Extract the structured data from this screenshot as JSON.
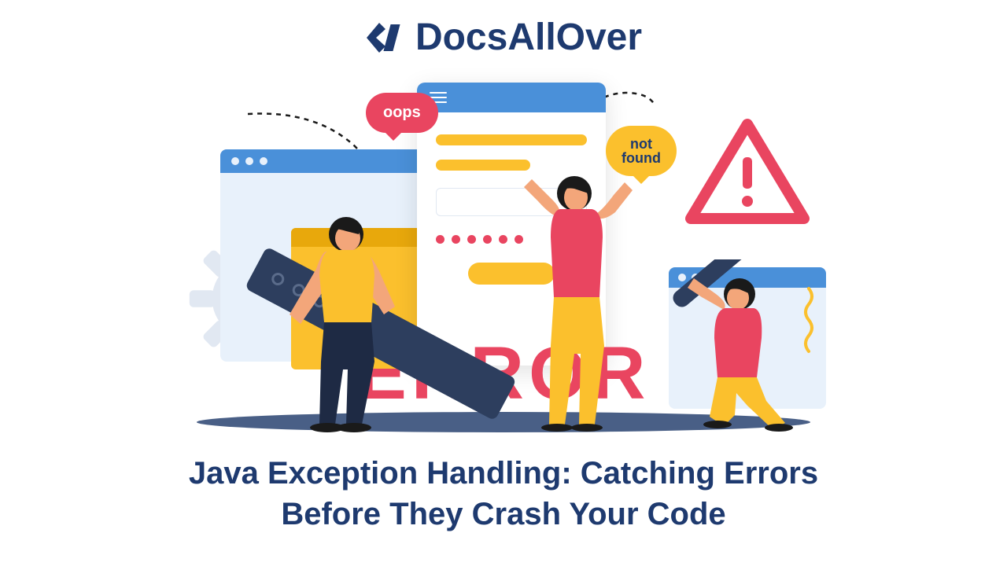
{
  "brand": "DocsAllOver",
  "illustration": {
    "bubble_oops": "oops",
    "bubble_not_found_line1": "not",
    "bubble_not_found_line2": "found",
    "error_label": "ERROR",
    "warning_glyph": "!"
  },
  "title_line1": "Java Exception Handling: Catching Errors",
  "title_line2": "Before They Crash Your Code",
  "colors": {
    "brand_navy": "#1e3a6f",
    "accent_yellow": "#fbc02d",
    "accent_pink": "#e94560",
    "accent_blue": "#4a90d9",
    "panel_light": "#e8f1fb",
    "dark_slate": "#2d3e5e"
  }
}
